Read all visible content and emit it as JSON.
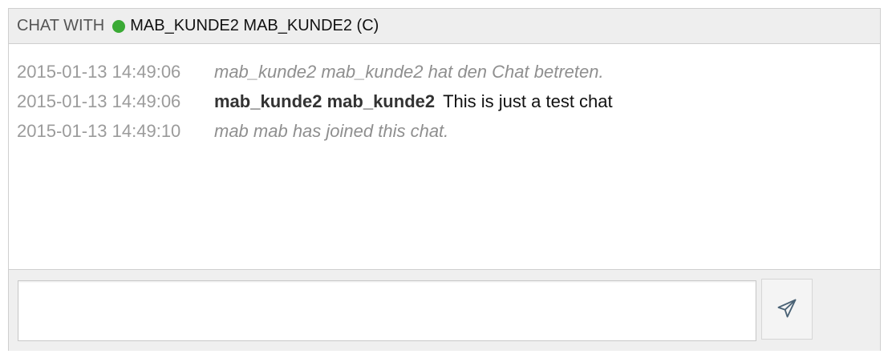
{
  "header": {
    "prefix": "CHAT WITH",
    "partner": "MAB_KUNDE2 MAB_KUNDE2 (C)",
    "status_color": "#3aaa35"
  },
  "messages": [
    {
      "timestamp": "2015-01-13 14:49:06",
      "type": "system",
      "text": "mab_kunde2 mab_kunde2 hat den Chat betreten."
    },
    {
      "timestamp": "2015-01-13 14:49:06",
      "type": "user",
      "author": "mab_kunde2 mab_kunde2",
      "text": "This is just a test chat"
    },
    {
      "timestamp": "2015-01-13 14:49:10",
      "type": "system",
      "text": "mab mab has joined this chat."
    }
  ],
  "composer": {
    "value": "",
    "placeholder": "",
    "send_icon": "paper-plane-icon"
  }
}
